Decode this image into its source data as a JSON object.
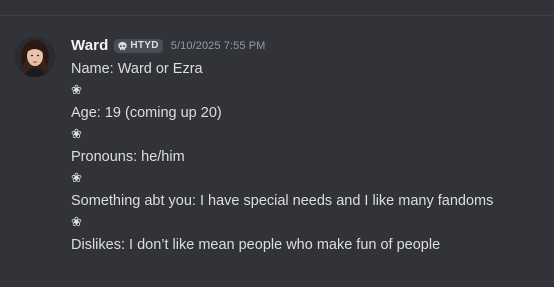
{
  "message": {
    "username": "Ward",
    "server_tag": {
      "icon": "skull-icon",
      "label": "HTYD"
    },
    "timestamp": "5/10/2025 7:55 PM",
    "lines": [
      "Name: Ward or Ezra",
      "❀",
      "Age: 19 (coming up 20)",
      "❀",
      "Pronouns: he/him",
      "❀",
      "Something abt you: I have special needs and I like many fandoms",
      "❀",
      "Dislikes: I don’t like mean people who make fun of people"
    ]
  },
  "colors": {
    "background": "#323339",
    "username": "#f2f3f5",
    "text": "#dbdee1",
    "timestamp": "#949ba4",
    "tag_background": "#4b4d55"
  }
}
